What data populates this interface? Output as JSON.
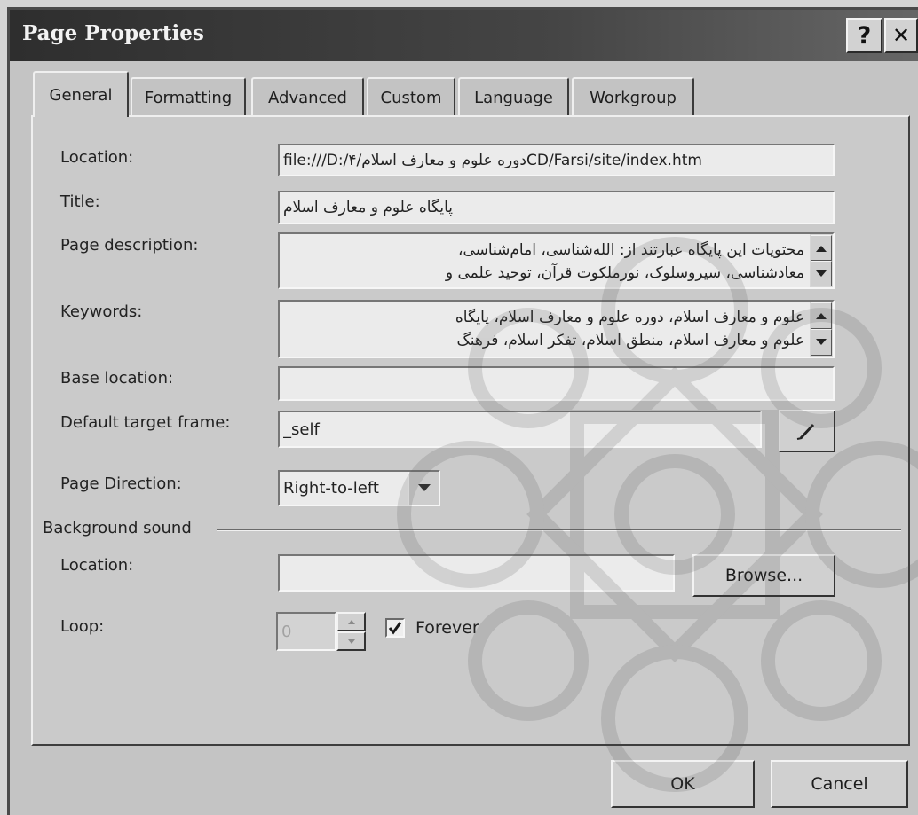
{
  "window": {
    "title": "Page Properties",
    "help_label": "?",
    "close_glyph": "✕"
  },
  "tabs": [
    {
      "label": "General",
      "selected": true
    },
    {
      "label": "Formatting",
      "selected": false
    },
    {
      "label": "Advanced",
      "selected": false
    },
    {
      "label": "Custom",
      "selected": false
    },
    {
      "label": "Language",
      "selected": false
    },
    {
      "label": "Workgroup",
      "selected": false
    }
  ],
  "general": {
    "location_label": "Location:",
    "location_value": "file:///D:/۴/دوره علوم و معارف اسلامCD/Farsi/site/index.htm",
    "title_label": "Title:",
    "title_value": "پایگاه علوم و معارف اسلام",
    "description_label": "Page description:",
    "description_lines": [
      "محتویات این پایگاه عبارتند از: الله‌شناسی، امام‌شناسی،",
      "معادشناسی، سیروسلوک، نورملکوت قرآن، توحید علمی و"
    ],
    "keywords_label": "Keywords:",
    "keywords_lines": [
      "علوم و معارف اسلام، دوره علوم و معارف اسلام، پایگاه",
      "علوم و معارف اسلام، منطق اسلام، تفکر اسلام، فرهنگ"
    ],
    "base_location_label": "Base location:",
    "base_location_value": "",
    "target_frame_label": "Default target frame:",
    "target_frame_value": "_self",
    "page_direction_label": "Page Direction:",
    "page_direction_value": "Right-to-left"
  },
  "background_sound": {
    "group_label": "Background sound",
    "location_label": "Location:",
    "location_value": "",
    "browse_label": "Browse...",
    "loop_label": "Loop:",
    "loop_value": "0",
    "loop_enabled": false,
    "forever_label": "Forever",
    "forever_checked": true
  },
  "buttons": {
    "ok_label": "OK",
    "cancel_label": "Cancel"
  },
  "icons": {
    "close": "close-icon",
    "target_frame_button": "pencil-icon",
    "page_direction_dropdown": "chevron-down-icon",
    "scroll_up": "scroll-up-icon",
    "scroll_down": "scroll-down-icon",
    "forever_checkbox": "checkmark-icon"
  },
  "colors": {
    "outer_bg": "#d4d4d4",
    "dialog_bg": "#c4c4c4",
    "panel_bg": "#cacaca",
    "title_bar": "#2e2e2e",
    "title_text": "#f2f2f2",
    "field_bg": "#ebebeb"
  }
}
